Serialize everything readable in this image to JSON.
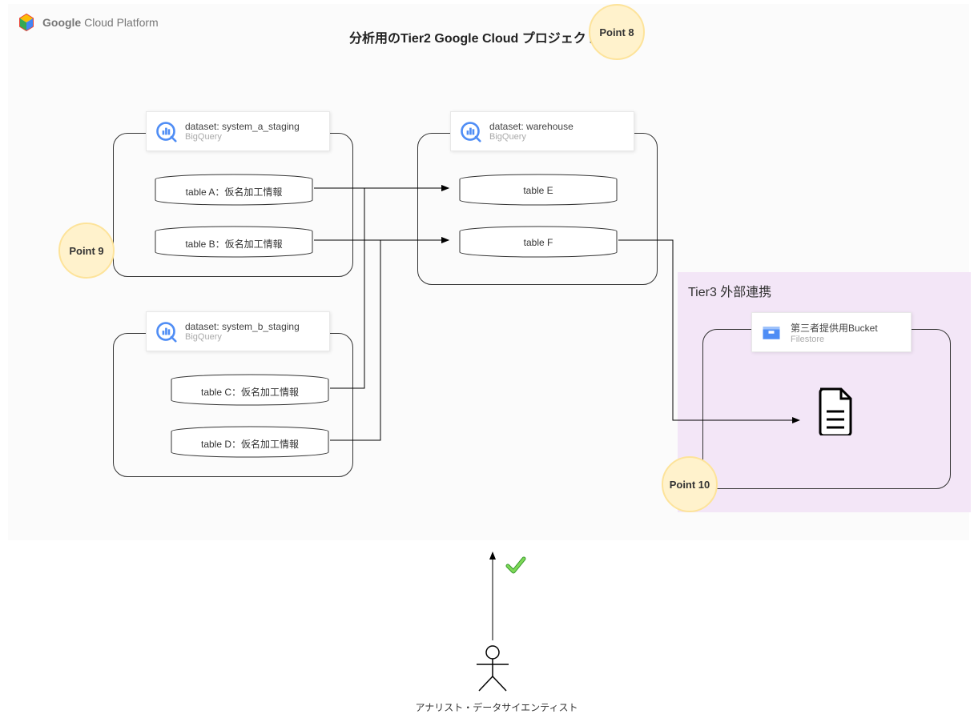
{
  "header": {
    "brand_bold": "Google",
    "brand_rest": " Cloud Platform",
    "project_title": "分析用のTier2 Google Cloud プロジェクト"
  },
  "points": {
    "p8": "Point 8",
    "p9": "Point 9",
    "p10": "Point 10"
  },
  "datasets": {
    "system_a": {
      "label": "dataset:  system_a_staging",
      "product": "BigQuery",
      "tables": {
        "a": "table A：仮名加工情報",
        "b": "table B：仮名加工情報"
      }
    },
    "system_b": {
      "label": "dataset:  system_b_staging",
      "product": "BigQuery",
      "tables": {
        "c": "table C：仮名加工情報",
        "d": "table D：仮名加工情報"
      }
    },
    "warehouse": {
      "label": "dataset:  warehouse",
      "product": "BigQuery",
      "tables": {
        "e": "table E",
        "f": "table F"
      }
    }
  },
  "tier3": {
    "title": "Tier3 外部連携",
    "bucket_label": "第三者提供用Bucket",
    "bucket_product": "Filestore"
  },
  "actor": {
    "label": "アナリスト・データサイエンティスト"
  }
}
